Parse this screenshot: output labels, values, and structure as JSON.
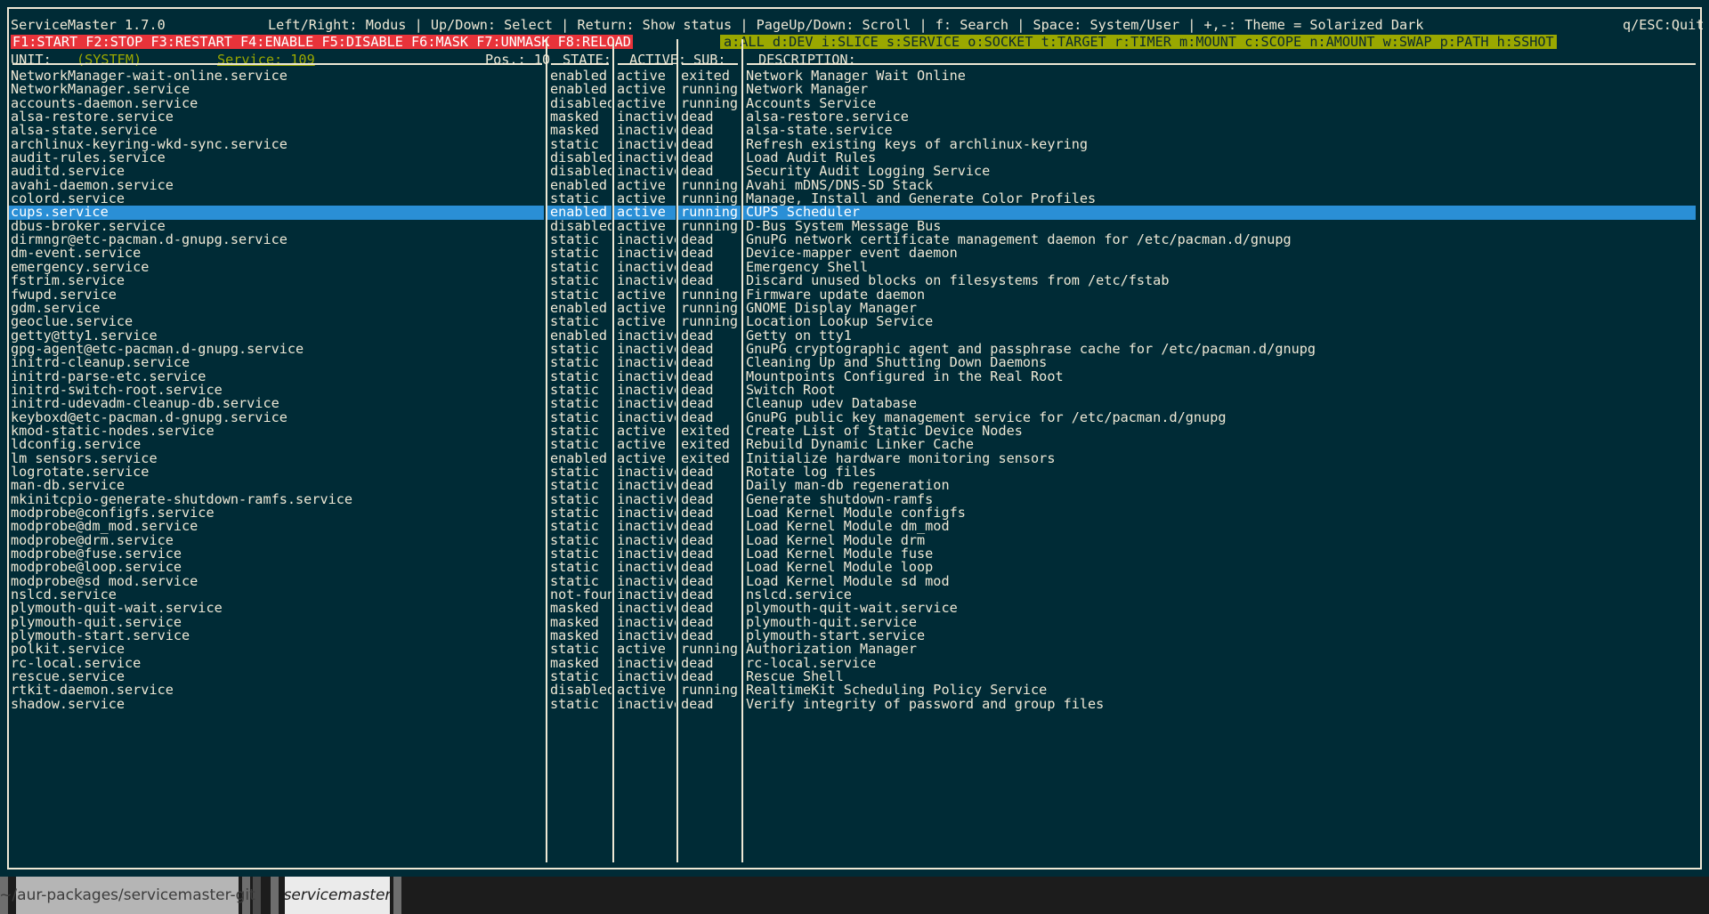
{
  "window": {
    "app_title": "ServiceMaster 1.7.0",
    "key_help": "Left/Right: Modus | Up/Down: Select | Return: Show status | PageUp/Down: Scroll | f: Search | Space: System/User | +,-: Theme = Solarized Dark",
    "quit_hint": "q/ESC:Quit",
    "function_keys": "F1:START F2:STOP F3:RESTART F4:ENABLE F5:DISABLE F6:MASK F7:UNMASK F8:RELOAD",
    "type_filters": "a:ALL d:DEV i:SLICE s:SERVICE o:SOCKET t:TARGET r:TIMER m:MOUNT c:SCOPE n:AMOUNT w:SWAP p:PATH h:SSHOT"
  },
  "status": {
    "unit_label": "UNIT:",
    "unit_scope": "(SYSTEM)",
    "service_count": "Service: 109",
    "position": "Pos.: 10"
  },
  "columns": {
    "unit": "UNIT:",
    "state": "STATE:",
    "active": "ACTIVE:",
    "sub": "SUB:",
    "description": "DESCRIPTION:"
  },
  "colors": {
    "background": "#002b36",
    "foreground": "#eee8d5",
    "accent_red": "#e8333a",
    "accent_olive": "#9aa800",
    "selection_blue": "#2a8fd6"
  },
  "taskbar": {
    "items": [
      {
        "label": "~/aur-packages/servicemaster-git",
        "active": false
      },
      {
        "label": "servicemaster",
        "active": true
      }
    ]
  },
  "selected_index": 10,
  "rows": [
    {
      "unit": "NetworkManager-wait-online.service",
      "state": "enabled",
      "active": "active",
      "sub": "exited",
      "description": "Network Manager Wait Online"
    },
    {
      "unit": "NetworkManager.service",
      "state": "enabled",
      "active": "active",
      "sub": "running",
      "description": "Network Manager"
    },
    {
      "unit": "accounts-daemon.service",
      "state": "disabled",
      "active": "active",
      "sub": "running",
      "description": "Accounts Service"
    },
    {
      "unit": "alsa-restore.service",
      "state": "masked",
      "active": "inactive",
      "sub": "dead",
      "description": "alsa-restore.service"
    },
    {
      "unit": "alsa-state.service",
      "state": "masked",
      "active": "inactive",
      "sub": "dead",
      "description": "alsa-state.service"
    },
    {
      "unit": "archlinux-keyring-wkd-sync.service",
      "state": "static",
      "active": "inactive",
      "sub": "dead",
      "description": "Refresh existing keys of archlinux-keyring"
    },
    {
      "unit": "audit-rules.service",
      "state": "disabled",
      "active": "inactive",
      "sub": "dead",
      "description": "Load Audit Rules"
    },
    {
      "unit": "auditd.service",
      "state": "disabled",
      "active": "inactive",
      "sub": "dead",
      "description": "Security Audit Logging Service"
    },
    {
      "unit": "avahi-daemon.service",
      "state": "enabled",
      "active": "active",
      "sub": "running",
      "description": "Avahi mDNS/DNS-SD Stack"
    },
    {
      "unit": "colord.service",
      "state": "static",
      "active": "active",
      "sub": "running",
      "description": "Manage, Install and Generate Color Profiles"
    },
    {
      "unit": "cups.service",
      "state": "enabled",
      "active": "active",
      "sub": "running",
      "description": "CUPS Scheduler"
    },
    {
      "unit": "dbus-broker.service",
      "state": "disabled",
      "active": "active",
      "sub": "running",
      "description": "D-Bus System Message Bus"
    },
    {
      "unit": "dirmngr@etc-pacman.d-gnupg.service",
      "state": "static",
      "active": "inactive",
      "sub": "dead",
      "description": "GnuPG network certificate management daemon for /etc/pacman.d/gnupg"
    },
    {
      "unit": "dm-event.service",
      "state": "static",
      "active": "inactive",
      "sub": "dead",
      "description": "Device-mapper event daemon"
    },
    {
      "unit": "emergency.service",
      "state": "static",
      "active": "inactive",
      "sub": "dead",
      "description": "Emergency Shell"
    },
    {
      "unit": "fstrim.service",
      "state": "static",
      "active": "inactive",
      "sub": "dead",
      "description": "Discard unused blocks on filesystems from /etc/fstab"
    },
    {
      "unit": "fwupd.service",
      "state": "static",
      "active": "active",
      "sub": "running",
      "description": "Firmware update daemon"
    },
    {
      "unit": "gdm.service",
      "state": "enabled",
      "active": "active",
      "sub": "running",
      "description": "GNOME Display Manager"
    },
    {
      "unit": "geoclue.service",
      "state": "static",
      "active": "active",
      "sub": "running",
      "description": "Location Lookup Service"
    },
    {
      "unit": "getty@tty1.service",
      "state": "enabled",
      "active": "inactive",
      "sub": "dead",
      "description": "Getty on tty1"
    },
    {
      "unit": "gpg-agent@etc-pacman.d-gnupg.service",
      "state": "static",
      "active": "inactive",
      "sub": "dead",
      "description": "GnuPG cryptographic agent and passphrase cache for /etc/pacman.d/gnupg"
    },
    {
      "unit": "initrd-cleanup.service",
      "state": "static",
      "active": "inactive",
      "sub": "dead",
      "description": "Cleaning Up and Shutting Down Daemons"
    },
    {
      "unit": "initrd-parse-etc.service",
      "state": "static",
      "active": "inactive",
      "sub": "dead",
      "description": "Mountpoints Configured in the Real Root"
    },
    {
      "unit": "initrd-switch-root.service",
      "state": "static",
      "active": "inactive",
      "sub": "dead",
      "description": "Switch Root"
    },
    {
      "unit": "initrd-udevadm-cleanup-db.service",
      "state": "static",
      "active": "inactive",
      "sub": "dead",
      "description": "Cleanup udev Database"
    },
    {
      "unit": "keyboxd@etc-pacman.d-gnupg.service",
      "state": "static",
      "active": "inactive",
      "sub": "dead",
      "description": "GnuPG public key management service for /etc/pacman.d/gnupg"
    },
    {
      "unit": "kmod-static-nodes.service",
      "state": "static",
      "active": "active",
      "sub": "exited",
      "description": "Create List of Static Device Nodes"
    },
    {
      "unit": "ldconfig.service",
      "state": "static",
      "active": "active",
      "sub": "exited",
      "description": "Rebuild Dynamic Linker Cache"
    },
    {
      "unit": "lm_sensors.service",
      "state": "enabled",
      "active": "active",
      "sub": "exited",
      "description": "Initialize hardware monitoring sensors"
    },
    {
      "unit": "logrotate.service",
      "state": "static",
      "active": "inactive",
      "sub": "dead",
      "description": "Rotate log files"
    },
    {
      "unit": "man-db.service",
      "state": "static",
      "active": "inactive",
      "sub": "dead",
      "description": "Daily man-db regeneration"
    },
    {
      "unit": "mkinitcpio-generate-shutdown-ramfs.service",
      "state": "static",
      "active": "inactive",
      "sub": "dead",
      "description": "Generate shutdown-ramfs"
    },
    {
      "unit": "modprobe@configfs.service",
      "state": "static",
      "active": "inactive",
      "sub": "dead",
      "description": "Load Kernel Module configfs"
    },
    {
      "unit": "modprobe@dm_mod.service",
      "state": "static",
      "active": "inactive",
      "sub": "dead",
      "description": "Load Kernel Module dm_mod"
    },
    {
      "unit": "modprobe@drm.service",
      "state": "static",
      "active": "inactive",
      "sub": "dead",
      "description": "Load Kernel Module drm"
    },
    {
      "unit": "modprobe@fuse.service",
      "state": "static",
      "active": "inactive",
      "sub": "dead",
      "description": "Load Kernel Module fuse"
    },
    {
      "unit": "modprobe@loop.service",
      "state": "static",
      "active": "inactive",
      "sub": "dead",
      "description": "Load Kernel Module loop"
    },
    {
      "unit": "modprobe@sd_mod.service",
      "state": "static",
      "active": "inactive",
      "sub": "dead",
      "description": "Load Kernel Module sd_mod"
    },
    {
      "unit": "nslcd.service",
      "state": "not-found",
      "active": "inactive",
      "sub": "dead",
      "description": "nslcd.service"
    },
    {
      "unit": "plymouth-quit-wait.service",
      "state": "masked",
      "active": "inactive",
      "sub": "dead",
      "description": "plymouth-quit-wait.service"
    },
    {
      "unit": "plymouth-quit.service",
      "state": "masked",
      "active": "inactive",
      "sub": "dead",
      "description": "plymouth-quit.service"
    },
    {
      "unit": "plymouth-start.service",
      "state": "masked",
      "active": "inactive",
      "sub": "dead",
      "description": "plymouth-start.service"
    },
    {
      "unit": "polkit.service",
      "state": "static",
      "active": "active",
      "sub": "running",
      "description": "Authorization Manager"
    },
    {
      "unit": "rc-local.service",
      "state": "masked",
      "active": "inactive",
      "sub": "dead",
      "description": "rc-local.service"
    },
    {
      "unit": "rescue.service",
      "state": "static",
      "active": "inactive",
      "sub": "dead",
      "description": "Rescue Shell"
    },
    {
      "unit": "rtkit-daemon.service",
      "state": "disabled",
      "active": "active",
      "sub": "running",
      "description": "RealtimeKit Scheduling Policy Service"
    },
    {
      "unit": "shadow.service",
      "state": "static",
      "active": "inactive",
      "sub": "dead",
      "description": "Verify integrity of password and group files"
    }
  ]
}
